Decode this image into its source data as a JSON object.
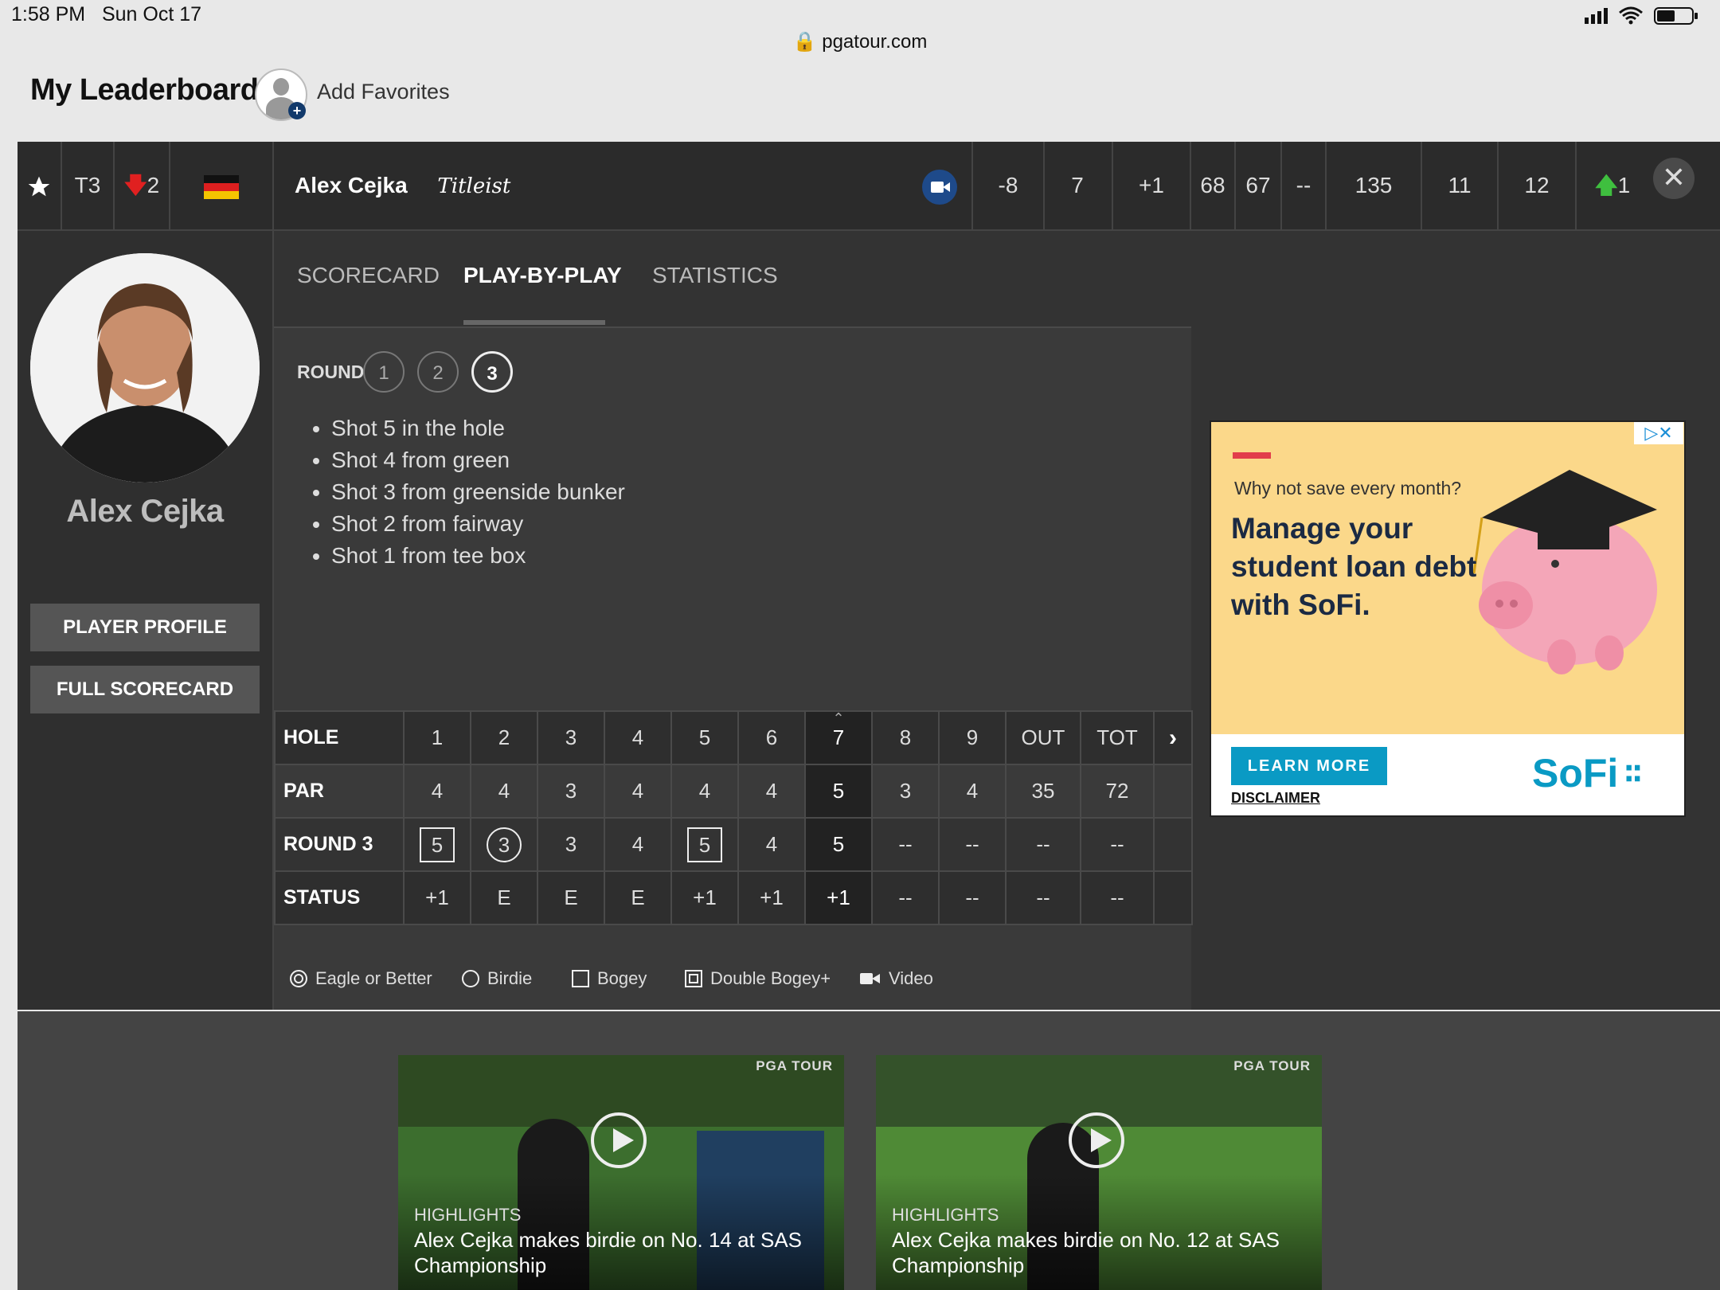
{
  "status_bar": {
    "time": "1:58 PM",
    "date": "Sun Oct 17",
    "url": "pgatour.com"
  },
  "header": {
    "title": "My Leaderboard",
    "add_favorites": "Add Favorites"
  },
  "player_row": {
    "position": "T3",
    "movement": "2",
    "movement_dir": "down",
    "flag": "germany-flag-icon",
    "name": "Alex Cejka",
    "sponsor": "Titleist",
    "to_par": "-8",
    "thru": "7",
    "today": "+1",
    "r1": "68",
    "r2": "67",
    "r3": "--",
    "total": "135",
    "stat_a": "11",
    "stat_b": "12",
    "proj_move": "1",
    "proj_dir": "up"
  },
  "player_card": {
    "name": "Alex Cejka",
    "profile_button": "PLAYER PROFILE",
    "scorecard_button": "FULL SCORECARD"
  },
  "tabs": [
    "SCORECARD",
    "PLAY-BY-PLAY",
    "STATISTICS"
  ],
  "active_tab": "PLAY-BY-PLAY",
  "round": {
    "label": "ROUND",
    "options": [
      "1",
      "2",
      "3"
    ],
    "selected": "3"
  },
  "shots": [
    "Shot 5 in the hole",
    "Shot 4 from green",
    "Shot 3 from greenside bunker",
    "Shot 2 from fairway",
    "Shot 1 from tee box"
  ],
  "scorecard": {
    "row_labels": [
      "HOLE",
      "PAR",
      "ROUND 3",
      "STATUS"
    ],
    "holes": [
      "1",
      "2",
      "3",
      "4",
      "5",
      "6",
      "7",
      "8",
      "9",
      "OUT",
      "TOT"
    ],
    "par": [
      "4",
      "4",
      "3",
      "4",
      "4",
      "4",
      "5",
      "3",
      "4",
      "35",
      "72"
    ],
    "round3": [
      "5",
      "3",
      "3",
      "4",
      "5",
      "4",
      "5",
      "--",
      "--",
      "--",
      "--"
    ],
    "status": [
      "+1",
      "E",
      "E",
      "E",
      "+1",
      "+1",
      "+1",
      "--",
      "--",
      "--",
      "--"
    ],
    "current_hole": "7"
  },
  "legend": [
    "Eagle or Better",
    "Birdie",
    "Bogey",
    "Double Bogey+",
    "Video"
  ],
  "ad": {
    "small": "Why not save every month?",
    "headline": "Manage your student loan debt with SoFi.",
    "cta": "LEARN MORE",
    "disclaimer": "DISCLAIMER",
    "logo": "SoFi",
    "accent": "#0a9ac4",
    "background": "#fbd88a"
  },
  "videos": [
    {
      "brand": "PGA TOUR",
      "category": "HIGHLIGHTS",
      "title": "Alex Cejka makes birdie on No. 14 at SAS Championship"
    },
    {
      "brand": "PGA TOUR",
      "category": "HIGHLIGHTS",
      "title": "Alex Cejka makes birdie on No. 12 at SAS Championship"
    }
  ]
}
